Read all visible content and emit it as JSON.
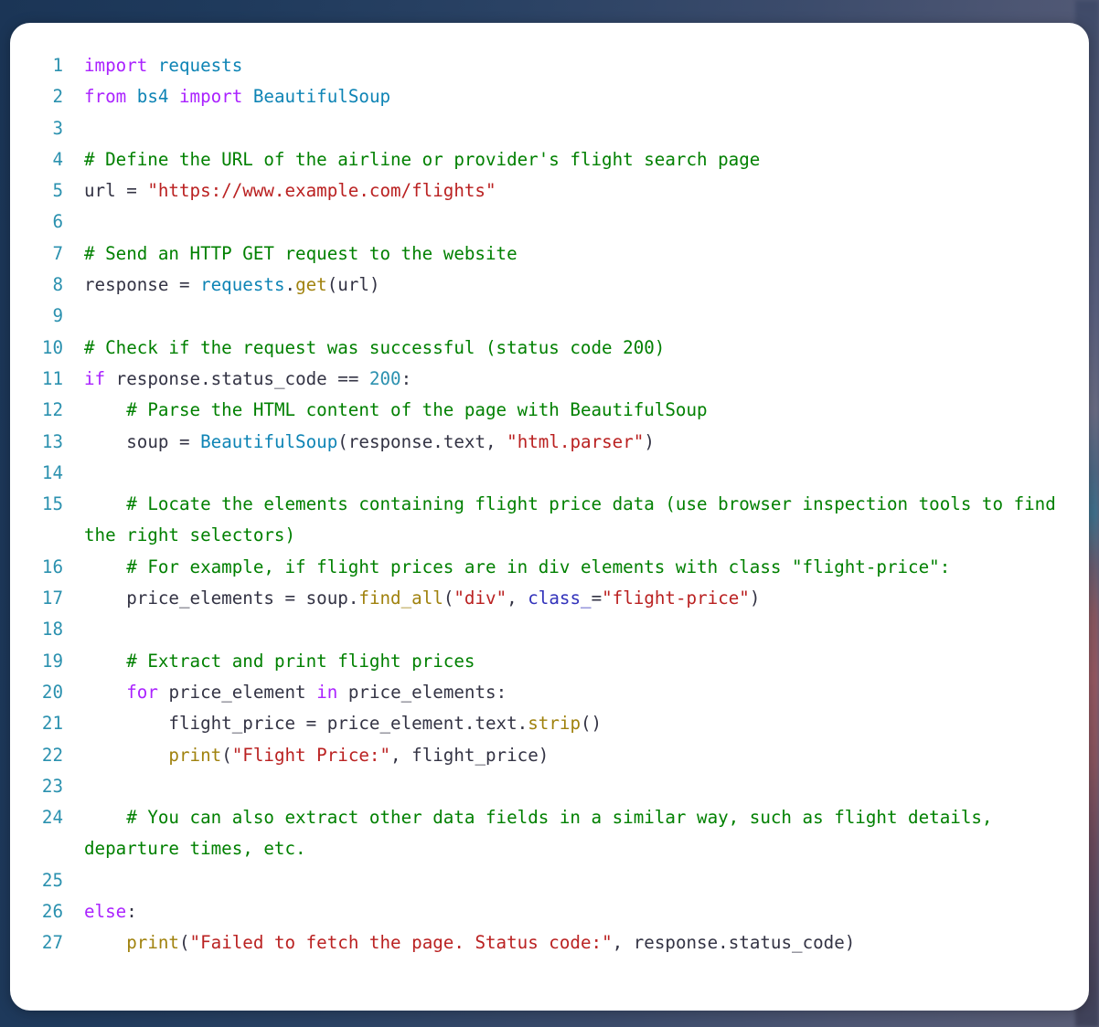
{
  "window": {
    "background_gradient_from": "#1b3556",
    "background_gradient_to": "#5b5f78",
    "card_background": "#ffffff",
    "card_radius_px": 22
  },
  "editor": {
    "language": "python",
    "font": "monospace",
    "font_size_px": 19,
    "line_height_px": 34,
    "gutter_color": "#2b91af",
    "wrap_enabled": true,
    "first_line_number": 1,
    "last_line_number": 27,
    "total_lines": 27,
    "theme_colors": {
      "keyword": "#aa22ff",
      "string": "#ba2121",
      "comment": "#008000",
      "function": "#a0820e",
      "class_or_module": "#0e84b5",
      "number": "#2b91af",
      "name": "#333344",
      "keyword_argument": "#3333bb"
    }
  },
  "lines": [
    {
      "n": "1",
      "text": "import requests"
    },
    {
      "n": "2",
      "text": "from bs4 import BeautifulSoup"
    },
    {
      "n": "3",
      "text": ""
    },
    {
      "n": "4",
      "text": "# Define the URL of the airline or provider's flight search page"
    },
    {
      "n": "5",
      "text": "url = \"https://www.example.com/flights\""
    },
    {
      "n": "6",
      "text": ""
    },
    {
      "n": "7",
      "text": "# Send an HTTP GET request to the website"
    },
    {
      "n": "8",
      "text": "response = requests.get(url)"
    },
    {
      "n": "9",
      "text": ""
    },
    {
      "n": "10",
      "text": "# Check if the request was successful (status code 200)"
    },
    {
      "n": "11",
      "text": "if response.status_code == 200:"
    },
    {
      "n": "12",
      "text": "    # Parse the HTML content of the page with BeautifulSoup"
    },
    {
      "n": "13",
      "text": "    soup = BeautifulSoup(response.text, \"html.parser\")"
    },
    {
      "n": "14",
      "text": ""
    },
    {
      "n": "15",
      "text": "    # Locate the elements containing flight price data (use browser inspection tools to find the right selectors)"
    },
    {
      "n": "16",
      "text": "    # For example, if flight prices are in div elements with class \"flight-price\":"
    },
    {
      "n": "17",
      "text": "    price_elements = soup.find_all(\"div\", class_=\"flight-price\")"
    },
    {
      "n": "18",
      "text": ""
    },
    {
      "n": "19",
      "text": "    # Extract and print flight prices"
    },
    {
      "n": "20",
      "text": "    for price_element in price_elements:"
    },
    {
      "n": "21",
      "text": "        flight_price = price_element.text.strip()"
    },
    {
      "n": "22",
      "text": "        print(\"Flight Price:\", flight_price)"
    },
    {
      "n": "23",
      "text": ""
    },
    {
      "n": "24",
      "text": "    # You can also extract other data fields in a similar way, such as flight details, departure times, etc."
    },
    {
      "n": "25",
      "text": ""
    },
    {
      "n": "26",
      "text": "else:"
    },
    {
      "n": "27",
      "text": "    print(\"Failed to fetch the page. Status code:\", response.status_code)"
    }
  ],
  "tokens": [
    [
      {
        "t": "import",
        "c": "kn"
      },
      {
        "t": " ",
        "c": "p"
      },
      {
        "t": "requests",
        "c": "nn"
      }
    ],
    [
      {
        "t": "from",
        "c": "kn"
      },
      {
        "t": " ",
        "c": "p"
      },
      {
        "t": "bs4",
        "c": "nn"
      },
      {
        "t": " ",
        "c": "p"
      },
      {
        "t": "import",
        "c": "kn"
      },
      {
        "t": " ",
        "c": "p"
      },
      {
        "t": "BeautifulSoup",
        "c": "nc"
      }
    ],
    [],
    [
      {
        "t": "# Define the URL of the airline or provider's flight search page",
        "c": "c"
      }
    ],
    [
      {
        "t": "url",
        "c": "n"
      },
      {
        "t": " = ",
        "c": "o"
      },
      {
        "t": "\"https://www.example.com/flights\"",
        "c": "s"
      }
    ],
    [],
    [
      {
        "t": "# Send an HTTP GET request to the website",
        "c": "c"
      }
    ],
    [
      {
        "t": "response",
        "c": "n"
      },
      {
        "t": " = ",
        "c": "o"
      },
      {
        "t": "requests",
        "c": "nn"
      },
      {
        "t": ".",
        "c": "o"
      },
      {
        "t": "get",
        "c": "nf"
      },
      {
        "t": "(",
        "c": "p"
      },
      {
        "t": "url",
        "c": "n"
      },
      {
        "t": ")",
        "c": "p"
      }
    ],
    [],
    [
      {
        "t": "# Check if the request was successful (status code 200)",
        "c": "c"
      }
    ],
    [
      {
        "t": "if",
        "c": "k"
      },
      {
        "t": " ",
        "c": "p"
      },
      {
        "t": "response",
        "c": "n"
      },
      {
        "t": ".",
        "c": "o"
      },
      {
        "t": "status_code",
        "c": "n"
      },
      {
        "t": " == ",
        "c": "o"
      },
      {
        "t": "200",
        "c": "mi"
      },
      {
        "t": ":",
        "c": "p"
      }
    ],
    [
      {
        "t": "    ",
        "c": "p"
      },
      {
        "t": "# Parse the HTML content of the page with BeautifulSoup",
        "c": "c"
      }
    ],
    [
      {
        "t": "    ",
        "c": "p"
      },
      {
        "t": "soup",
        "c": "n"
      },
      {
        "t": " = ",
        "c": "o"
      },
      {
        "t": "BeautifulSoup",
        "c": "nc"
      },
      {
        "t": "(",
        "c": "p"
      },
      {
        "t": "response",
        "c": "n"
      },
      {
        "t": ".",
        "c": "o"
      },
      {
        "t": "text",
        "c": "n"
      },
      {
        "t": ", ",
        "c": "p"
      },
      {
        "t": "\"html.parser\"",
        "c": "s"
      },
      {
        "t": ")",
        "c": "p"
      }
    ],
    [],
    [
      {
        "t": "    ",
        "c": "p"
      },
      {
        "t": "# Locate the elements containing flight price data (use browser inspection tools to find the right selectors)",
        "c": "c"
      }
    ],
    [
      {
        "t": "    ",
        "c": "p"
      },
      {
        "t": "# For example, if flight prices are in div elements with class \"flight-price\":",
        "c": "c"
      }
    ],
    [
      {
        "t": "    ",
        "c": "p"
      },
      {
        "t": "price_elements",
        "c": "n"
      },
      {
        "t": " = ",
        "c": "o"
      },
      {
        "t": "soup",
        "c": "n"
      },
      {
        "t": ".",
        "c": "o"
      },
      {
        "t": "find_all",
        "c": "nf"
      },
      {
        "t": "(",
        "c": "p"
      },
      {
        "t": "\"div\"",
        "c": "s"
      },
      {
        "t": ", ",
        "c": "p"
      },
      {
        "t": "class_",
        "c": "kw"
      },
      {
        "t": "=",
        "c": "o"
      },
      {
        "t": "\"flight-price\"",
        "c": "s"
      },
      {
        "t": ")",
        "c": "p"
      }
    ],
    [],
    [
      {
        "t": "    ",
        "c": "p"
      },
      {
        "t": "# Extract and print flight prices",
        "c": "c"
      }
    ],
    [
      {
        "t": "    ",
        "c": "p"
      },
      {
        "t": "for",
        "c": "k"
      },
      {
        "t": " ",
        "c": "p"
      },
      {
        "t": "price_element",
        "c": "n"
      },
      {
        "t": " ",
        "c": "p"
      },
      {
        "t": "in",
        "c": "k"
      },
      {
        "t": " ",
        "c": "p"
      },
      {
        "t": "price_elements",
        "c": "n"
      },
      {
        "t": ":",
        "c": "p"
      }
    ],
    [
      {
        "t": "        ",
        "c": "p"
      },
      {
        "t": "flight_price",
        "c": "n"
      },
      {
        "t": " = ",
        "c": "o"
      },
      {
        "t": "price_element",
        "c": "n"
      },
      {
        "t": ".",
        "c": "o"
      },
      {
        "t": "text",
        "c": "n"
      },
      {
        "t": ".",
        "c": "o"
      },
      {
        "t": "strip",
        "c": "nf"
      },
      {
        "t": "()",
        "c": "p"
      }
    ],
    [
      {
        "t": "        ",
        "c": "p"
      },
      {
        "t": "print",
        "c": "nb"
      },
      {
        "t": "(",
        "c": "p"
      },
      {
        "t": "\"Flight Price:\"",
        "c": "s"
      },
      {
        "t": ", ",
        "c": "p"
      },
      {
        "t": "flight_price",
        "c": "n"
      },
      {
        "t": ")",
        "c": "p"
      }
    ],
    [],
    [
      {
        "t": "    ",
        "c": "p"
      },
      {
        "t": "# You can also extract other data fields in a similar way, such as flight details, departure times, etc.",
        "c": "c"
      }
    ],
    [],
    [
      {
        "t": "else",
        "c": "k"
      },
      {
        "t": ":",
        "c": "p"
      }
    ],
    [
      {
        "t": "    ",
        "c": "p"
      },
      {
        "t": "print",
        "c": "nb"
      },
      {
        "t": "(",
        "c": "p"
      },
      {
        "t": "\"Failed to fetch the page. Status code:\"",
        "c": "s"
      },
      {
        "t": ", ",
        "c": "p"
      },
      {
        "t": "response",
        "c": "n"
      },
      {
        "t": ".",
        "c": "o"
      },
      {
        "t": "status_code",
        "c": "n"
      },
      {
        "t": ")",
        "c": "p"
      }
    ]
  ]
}
